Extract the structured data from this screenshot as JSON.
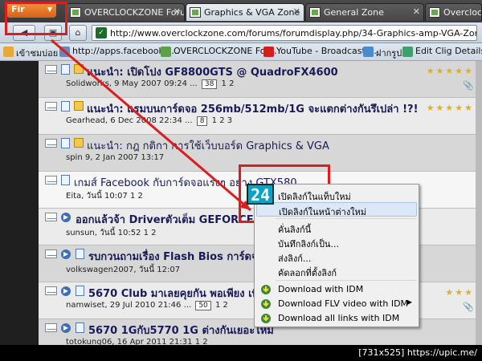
{
  "browser": {
    "menu_label": "Fir",
    "tabs": [
      {
        "label": "OVERCLOCKZONE Foru",
        "active": false
      },
      {
        "label": "Graphics & VGA Zone",
        "active": true
      },
      {
        "label": "General Zone",
        "active": false
      },
      {
        "label": "Overclocking Zone",
        "active": false
      }
    ],
    "url": "http://www.overclockzone.com/forums/forumdisplay.php/34-Graphics-amp-VGA-Zone",
    "bookmarks": [
      {
        "label": "เข้าชมบ่อย",
        "icon": "star-icon",
        "color": "#e6a93a"
      },
      {
        "label": "http://apps.facebook.c...",
        "icon": "globe-icon",
        "color": "#6b86b8"
      },
      {
        "label": "OVERCLOCKZONE For...",
        "icon": "site-icon",
        "color": "#5e9f4a"
      },
      {
        "label": "YouTube - Broadcast ...",
        "icon": "youtube-icon",
        "color": "#d02020"
      },
      {
        "label": "ฝากรูป",
        "icon": "image-icon",
        "color": "#4a8bd0"
      },
      {
        "label": "Edit Clig Details",
        "icon": "page-icon",
        "color": "#3aa36b"
      }
    ]
  },
  "threads": [
    {
      "title": "แนะนำ: เปิดโปง GF8800GTS @ QuadroFX4600",
      "meta": "Solidworks, 9 May 2007 09:24",
      "pages": [
        "...",
        "38",
        "1",
        "2"
      ],
      "stars": "★★★★★",
      "clip": true
    },
    {
      "title": "แนะนำ: แรมบนการ์ดจอ 256mb/512mb/1G จะแตกต่างกันรึเปล่า !?!",
      "meta": "Gearhead, 6 Dec 2008 22:34",
      "pages": [
        "...",
        "8",
        "1",
        "2",
        "3"
      ],
      "stars": "★★★★★",
      "clip": false
    },
    {
      "title": "แนะนำ: กฎ กติกา การใช้เว็บบอร์ด Graphics & VGA",
      "meta": "spin 9, 2 Jan 2007 13:17",
      "pages": [],
      "stars": "",
      "clip": false
    },
    {
      "title": "เกมส์ Facebook กับการ์ดจอแรงๆ อย่าง GTX580",
      "meta": "Eita, วันนี้ 10:07",
      "pages": [
        "1",
        "2"
      ],
      "stars": "",
      "clip": false
    },
    {
      "title": "ออกแล้วจ้า Driverตัวเต็ม GEFORCE D",
      "meta": "sunsun, วันนี้ 10:52",
      "pages": [
        "1",
        "2"
      ],
      "stars": "",
      "clip": false
    },
    {
      "title": "รบกวนถามเรื่อง Flash Bios การ์ดจอแ",
      "meta": "volkswagen2007, วันนี้ 12:07",
      "pages": [],
      "stars": "",
      "clip": false
    },
    {
      "title": "5670 Club มาเลยคุยกัน พอเพียง เพียง",
      "meta": "namwiset, 29 Jul 2010 21:46",
      "pages": [
        "...",
        "50",
        "1",
        "2"
      ],
      "stars": "★★★",
      "clip": true
    },
    {
      "title": "5670 1Gกับ5770 1G ต่างกันเยอะไหม",
      "meta": "totokung06, 16 Apr 2011 21:31",
      "pages": [
        "1",
        "2"
      ],
      "stars": "",
      "clip": false
    }
  ],
  "context_menu": {
    "items": [
      {
        "label": "เปิดลิงก์ในแท็บใหม่",
        "selected": false,
        "icon": "",
        "submenu": false
      },
      {
        "label": "เปิดลิงก์ในหน้าต่างใหม่",
        "selected": true,
        "icon": "",
        "submenu": false
      },
      {
        "label": "คั่นลิงก์นี้",
        "selected": false,
        "icon": "",
        "submenu": false
      },
      {
        "label": "บันทึกลิงก์เป็น...",
        "selected": false,
        "icon": "",
        "submenu": false
      },
      {
        "label": "ส่งลิงก์...",
        "selected": false,
        "icon": "",
        "submenu": false
      },
      {
        "label": "คัดลอกที่ตั้งลิงก์",
        "selected": false,
        "icon": "",
        "submenu": false
      },
      {
        "label": "Download with IDM",
        "selected": false,
        "icon": "idm-icon",
        "submenu": false
      },
      {
        "label": "Download FLV video with IDM",
        "selected": false,
        "icon": "idm-icon",
        "submenu": true
      },
      {
        "label": "Download all links with IDM",
        "selected": false,
        "icon": "idm-icon",
        "submenu": false
      }
    ]
  },
  "annotation": {
    "logo_text": "24",
    "accent": "#d81e1e"
  },
  "footer": {
    "text": "[731x525] https://upic.me/"
  }
}
